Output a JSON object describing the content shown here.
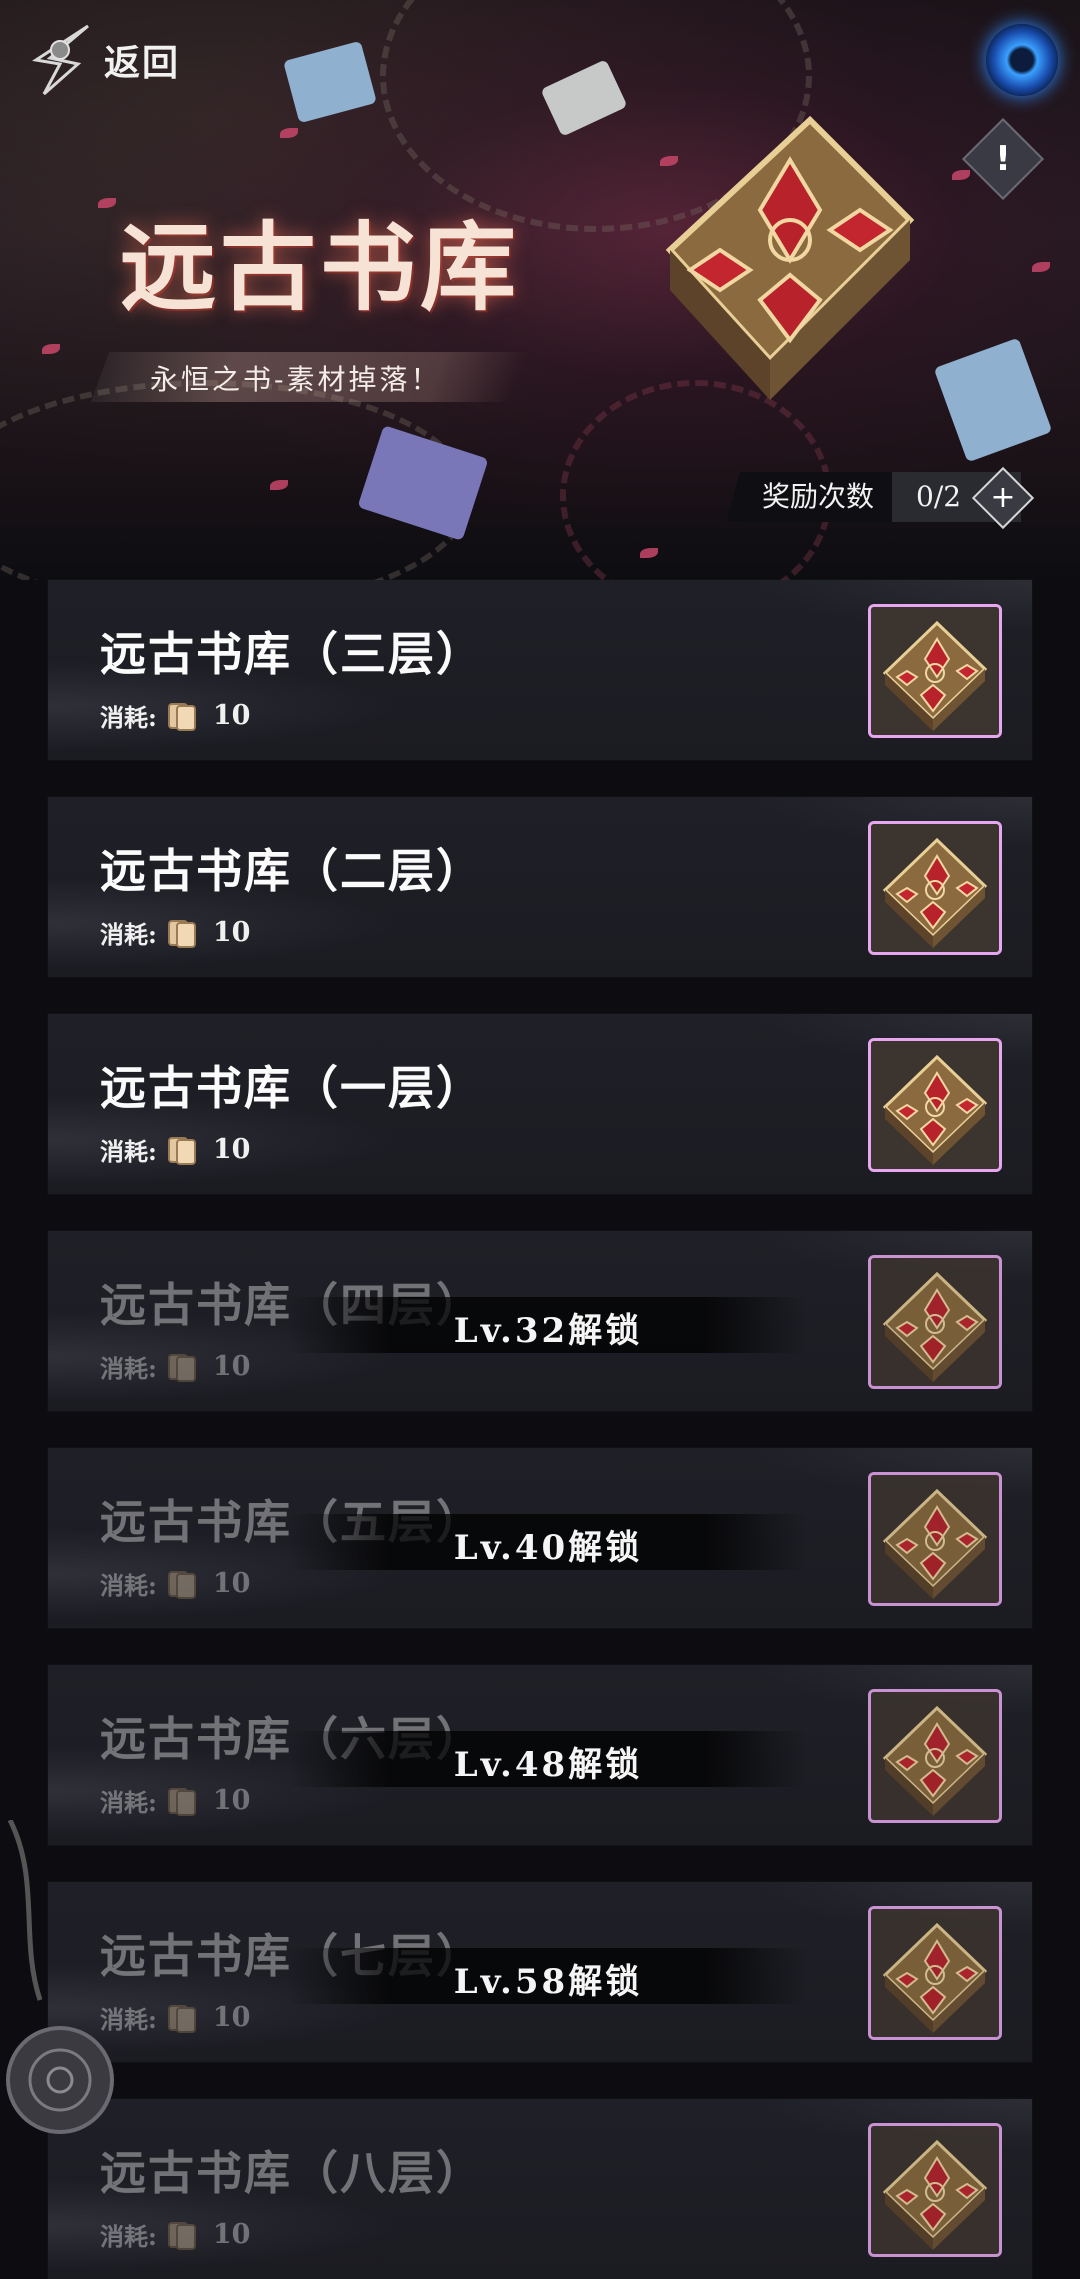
{
  "header": {
    "back_label": "返回",
    "title": "远古书库",
    "subtitle": "永恒之书-素材掉落！",
    "reward_label": "奖励次数",
    "reward_count": "0/2",
    "info_symbol": "!",
    "plus_symbol": "+"
  },
  "floors": [
    {
      "title": "远古书库（三层）",
      "cost_label": "消耗:",
      "cost": "10",
      "locked": false
    },
    {
      "title": "远古书库（二层）",
      "cost_label": "消耗:",
      "cost": "10",
      "locked": false
    },
    {
      "title": "远古书库（一层）",
      "cost_label": "消耗:",
      "cost": "10",
      "locked": false
    },
    {
      "title": "远古书库（四层）",
      "cost_label": "消耗:",
      "cost": "10",
      "locked": true,
      "unlock": "Lv.32解锁"
    },
    {
      "title": "远古书库（五层）",
      "cost_label": "消耗:",
      "cost": "10",
      "locked": true,
      "unlock": "Lv.40解锁"
    },
    {
      "title": "远古书库（六层）",
      "cost_label": "消耗:",
      "cost": "10",
      "locked": true,
      "unlock": "Lv.48解锁"
    },
    {
      "title": "远古书库（七层）",
      "cost_label": "消耗:",
      "cost": "10",
      "locked": true,
      "unlock": "Lv.58解锁"
    },
    {
      "title": "远古书库（八层）",
      "cost_label": "消耗:",
      "cost": "10",
      "locked": true,
      "unlock": ""
    }
  ],
  "colors": {
    "card_bg": "#1d1e24",
    "thumb_border": "#e7a6f0",
    "accent_red": "#c8476a",
    "orb_blue": "#3aa0ff"
  },
  "icons": {
    "back": "back-arrow-icon",
    "orb": "orb-icon",
    "info": "info-icon",
    "plus": "plus-icon",
    "cost": "paper-scroll-icon",
    "reward_item": "ancient-book-icon"
  }
}
